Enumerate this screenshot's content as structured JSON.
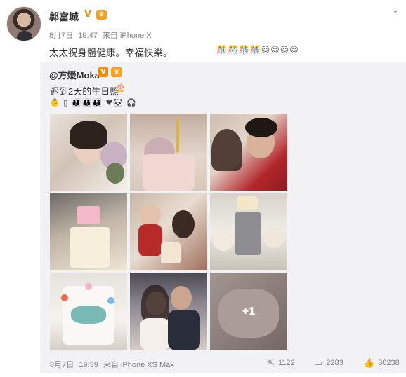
{
  "post": {
    "author": "郭富城",
    "verified_mark": "V",
    "vip_mark": "♛",
    "date": "8月7日",
    "time": "19:47",
    "source": "来自 iPhone X",
    "text": "太太祝身體健康。幸福快樂。",
    "emoji_tail": "🎊🎊🎊🎊☺☺☺☺"
  },
  "menu_icon": "chevron-down-icon",
  "repost": {
    "user": "@方媛Moka",
    "verified_mark": "V",
    "vip_mark": "♛",
    "text": "迟到2天的生日照",
    "cake_emoji": "🎂",
    "emoji_line": "👶 ▯ 👪👪👪 ♥🐼 🎧",
    "more_count": "+1",
    "date": "8月7日",
    "time": "19:39",
    "source": "来自 iPhone XS Max",
    "actions": {
      "repost_count": "1122",
      "comment_count": "2283",
      "like_count": "30238"
    }
  },
  "colors": {
    "accent_orange": "#f78b00",
    "meta_gray": "#808080",
    "repost_bg": "#f2f2f5"
  }
}
